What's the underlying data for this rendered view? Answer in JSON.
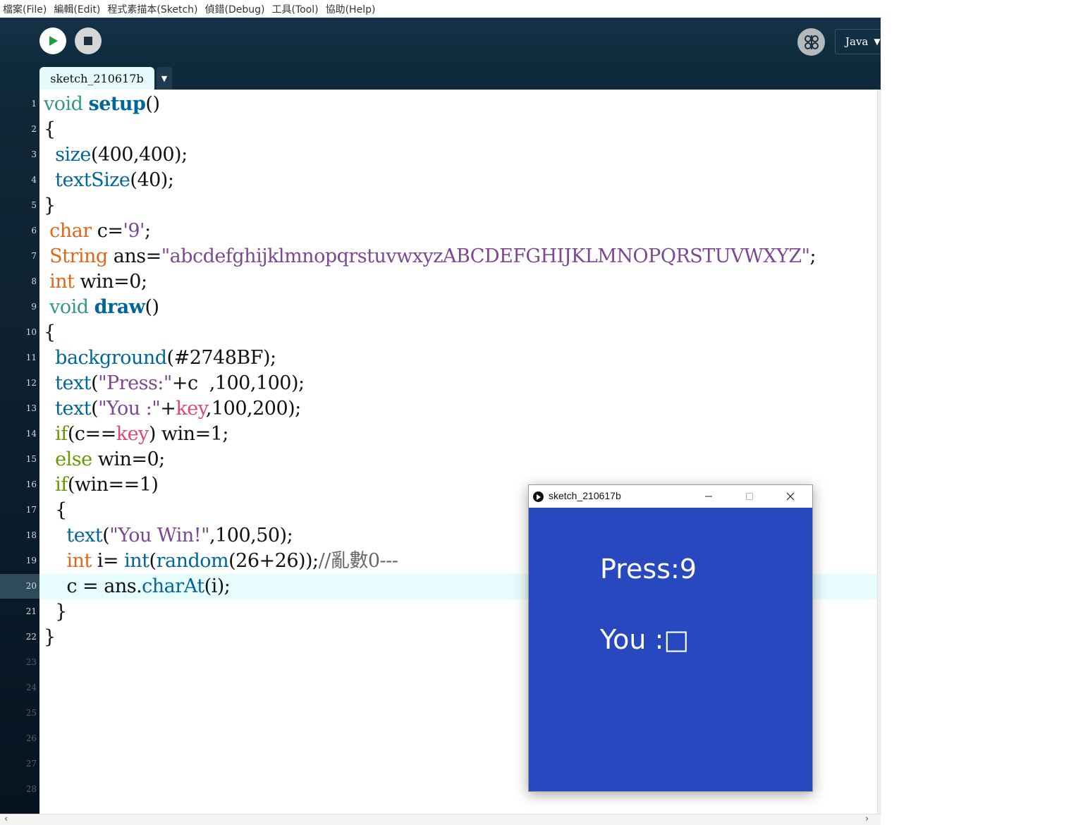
{
  "menu": [
    "檔案(File)",
    "編輯(Edit)",
    "程式素描本(Sketch)",
    "偵錯(Debug)",
    "工具(Tool)",
    "協助(Help)"
  ],
  "toolbar": {
    "mode_label": "Java"
  },
  "tab": {
    "name": "sketch_210617b"
  },
  "editor": {
    "current_line": 20,
    "line_numbers": [
      "1",
      "2",
      "3",
      "4",
      "5",
      "6",
      "7",
      "8",
      "9",
      "10",
      "11",
      "12",
      "13",
      "14",
      "15",
      "16",
      "17",
      "18",
      "19",
      "20",
      "21",
      "22",
      "23",
      "24",
      "25",
      "26",
      "27",
      "28"
    ],
    "lines": [
      "void setup()",
      "{",
      "  size(400,400);",
      "  textSize(40);",
      "}",
      " char c='9';",
      " String ans=\"abcdefghijklmnopqrstuvwxyzABCDEFGHIJKLMNOPQRSTUVWXYZ\";",
      " int win=0;",
      " void draw()",
      "{",
      "  background(#2748BF);",
      "  text(\"Press:\"+c  ,100,100);",
      "  text(\"You :\"+key,100,200);",
      "  if(c==key) win=1;",
      "  else win=0;",
      "  if(win==1)",
      "  {",
      "    text(\"You Win!\",100,50);",
      "    int i= int(random(26+26));//亂數0---",
      "    c = ans.charAt(i);",
      "  }",
      "}"
    ]
  },
  "sketch_window": {
    "title": "sketch_210617b",
    "canvas_color": "#2748BF",
    "press_text": "Press:9",
    "you_text": "You :□"
  },
  "colors": {
    "toolbar_bg": "#143348",
    "keyword": "#33997e",
    "type": "#e2661a",
    "function": "#006699",
    "string": "#7d4793",
    "builtin_var": "#d94a7a",
    "control": "#669900",
    "comment": "#666666"
  }
}
